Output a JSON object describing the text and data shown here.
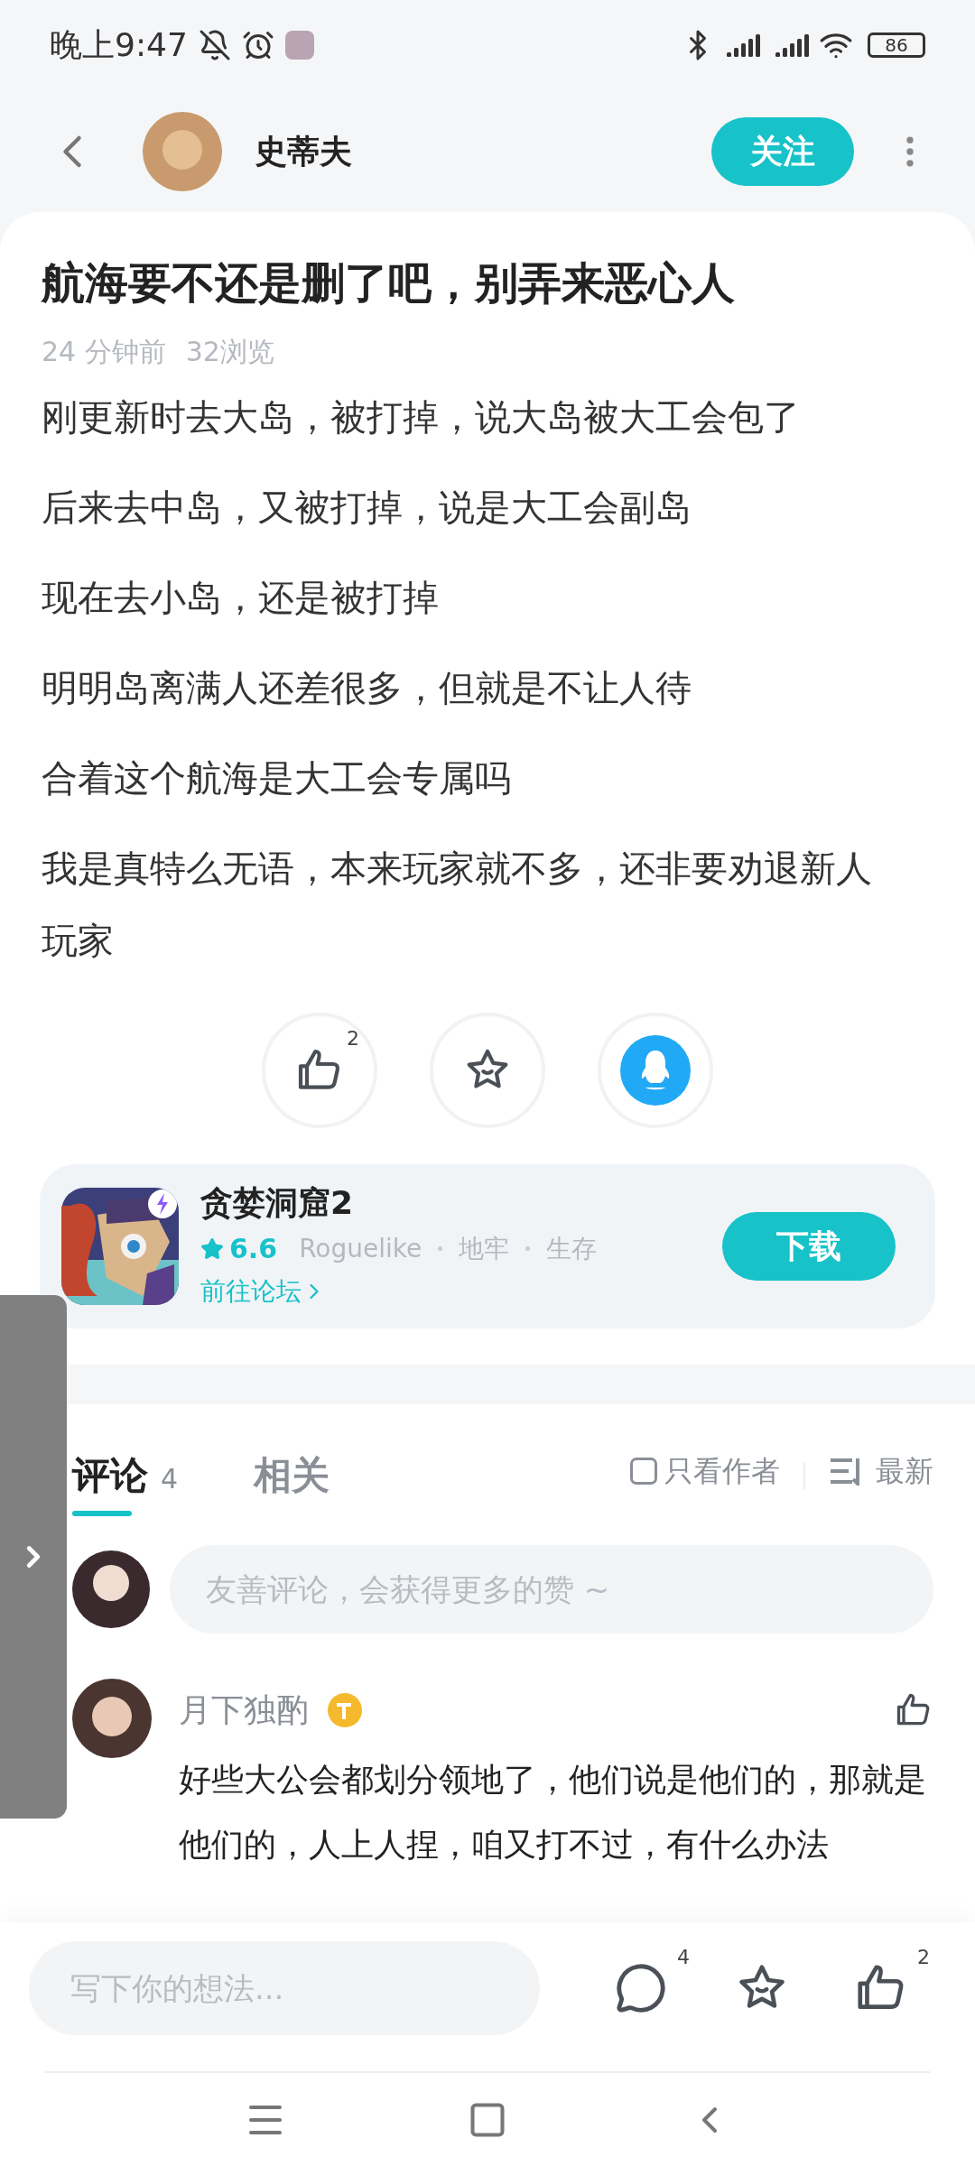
{
  "status_bar": {
    "time": "晚上9:47",
    "battery": "86"
  },
  "header": {
    "user_name": "史蒂夫",
    "follow_button": "关注"
  },
  "post": {
    "title": "航海要不还是删了吧，别弄来恶心人",
    "time": "24 分钟前",
    "views": "32浏览",
    "paragraphs": [
      "刚更新时去大岛，被打掉，说大岛被大工会包了",
      "后来去中岛，又被打掉，说是大工会副岛",
      "现在去小岛，还是被打掉",
      "明明岛离满人还差很多，但就是不让人待",
      "合着这个航海是大工会专属吗",
      "我是真特么无语，本来玩家就不多，还非要劝退新人玩家"
    ],
    "like_count": "2"
  },
  "game_card": {
    "name": "贪婪洞窟2",
    "rating": "6.6",
    "tags": [
      "Roguelike",
      "地牢",
      "生存"
    ],
    "forum_link": "前往论坛",
    "download_button": "下载"
  },
  "tabs": [
    {
      "label": "评论",
      "count": "4",
      "selected": true
    },
    {
      "label": "相关",
      "selected": false
    }
  ],
  "filter": {
    "label": "只看作者",
    "checked": false
  },
  "sort": {
    "label": "最新"
  },
  "comment_input": {
    "placeholder": "友善评论，会获得更多的赞 ~"
  },
  "comments": [
    {
      "name": "月下独酌",
      "text": "好些大公会都划分领地了，他们说是他们的，那就是他们的，人上人捏，咱又打不过，有什么办法"
    }
  ],
  "bottom_bar": {
    "placeholder": "写下你的想法...",
    "comment_count": "4",
    "like_count": "2"
  }
}
